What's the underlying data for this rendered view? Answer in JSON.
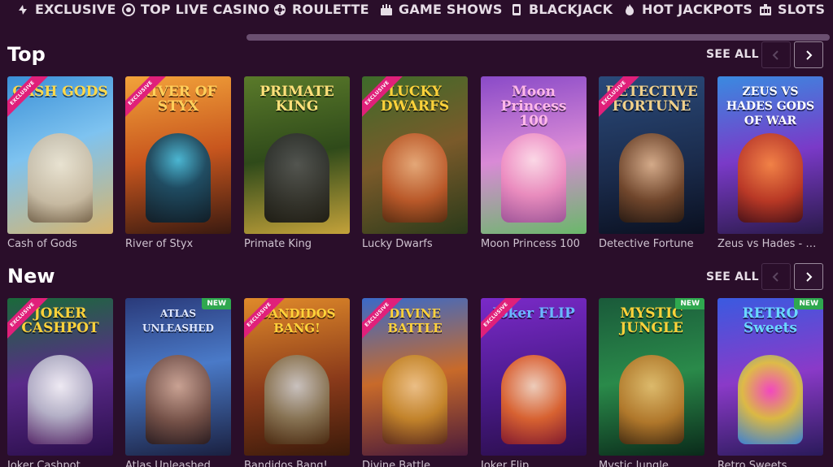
{
  "nav": {
    "categories": [
      {
        "label": "EXCLUSIVE",
        "icon": "exclusive-icon"
      },
      {
        "label": "TOP LIVE CASINO",
        "icon": "live-casino-icon"
      },
      {
        "label": "ROULETTE",
        "icon": "roulette-icon"
      },
      {
        "label": "GAME SHOWS",
        "icon": "game-shows-icon"
      },
      {
        "label": "BLACKJACK",
        "icon": "blackjack-icon"
      },
      {
        "label": "HOT JACKPOTS",
        "icon": "hot-jackpots-icon"
      },
      {
        "label": "SLOTS",
        "icon": "slots-icon"
      }
    ]
  },
  "sections": [
    {
      "title": "Top",
      "see_all": "SEE ALL",
      "games": [
        {
          "name": "Cash of Gods",
          "logo": "CASH GODS",
          "badge": "EXCLUSIVE"
        },
        {
          "name": "River of Styx",
          "logo": "RIVER OF STYX",
          "badge": "EXCLUSIVE"
        },
        {
          "name": "Primate King",
          "logo": "PRIMATE KING",
          "badge": ""
        },
        {
          "name": "Lucky Dwarfs",
          "logo": "LUCKY DWARFS",
          "badge": "EXCLUSIVE"
        },
        {
          "name": "Moon Princess 100",
          "logo": "Moon Princess 100",
          "badge": ""
        },
        {
          "name": "Detective Fortune",
          "logo": "DETECTIVE FORTUNE",
          "badge": "EXCLUSIVE"
        },
        {
          "name": "Zeus vs Hades - G...",
          "logo": "ZEUS VS HADES GODS OF WAR",
          "badge": ""
        }
      ]
    },
    {
      "title": "New",
      "see_all": "SEE ALL",
      "games": [
        {
          "name": "Joker Cashpot",
          "logo": "JOKER CASHPOT",
          "badge": "EXCLUSIVE"
        },
        {
          "name": "Atlas Unleashed",
          "logo": "ATLAS UNLEASHED",
          "badge": "NEW"
        },
        {
          "name": "Bandidos Bang!",
          "logo": "BANDIDOS BANG!",
          "badge": "EXCLUSIVE"
        },
        {
          "name": "Divine Battle",
          "logo": "DIVINE BATTLE",
          "badge": "EXCLUSIVE"
        },
        {
          "name": "Joker Flip",
          "logo": "Joker FLIP",
          "badge": "EXCLUSIVE"
        },
        {
          "name": "Mystic Jungle",
          "logo": "MYSTIC JUNGLE",
          "badge": "NEW"
        },
        {
          "name": "Retro Sweets",
          "logo": "RETRO Sweets",
          "badge": "NEW"
        }
      ]
    }
  ],
  "colors": {
    "background": "#2a0e2a",
    "exclusive_ribbon": "#e0207a",
    "new_badge": "#2fa84f"
  }
}
